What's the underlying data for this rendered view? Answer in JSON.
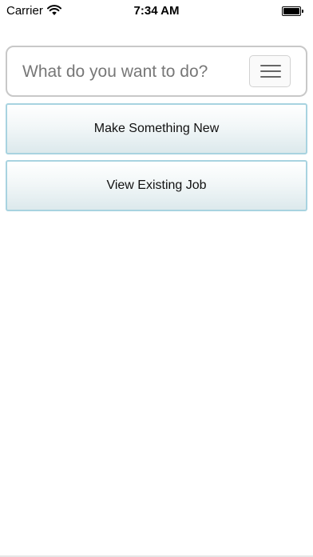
{
  "status_bar": {
    "carrier": "Carrier",
    "time": "7:34 AM",
    "wifi_icon": "wifi-icon",
    "battery_icon": "battery-icon"
  },
  "prompt": {
    "text": "What do you want to do?",
    "menu_icon": "hamburger-menu-icon"
  },
  "actions": {
    "make_new": "Make Something New",
    "view_existing": "View Existing Job"
  },
  "colors": {
    "button_border": "#a8d3e0",
    "prompt_border": "#c8c8c8",
    "prompt_text": "#777777"
  }
}
